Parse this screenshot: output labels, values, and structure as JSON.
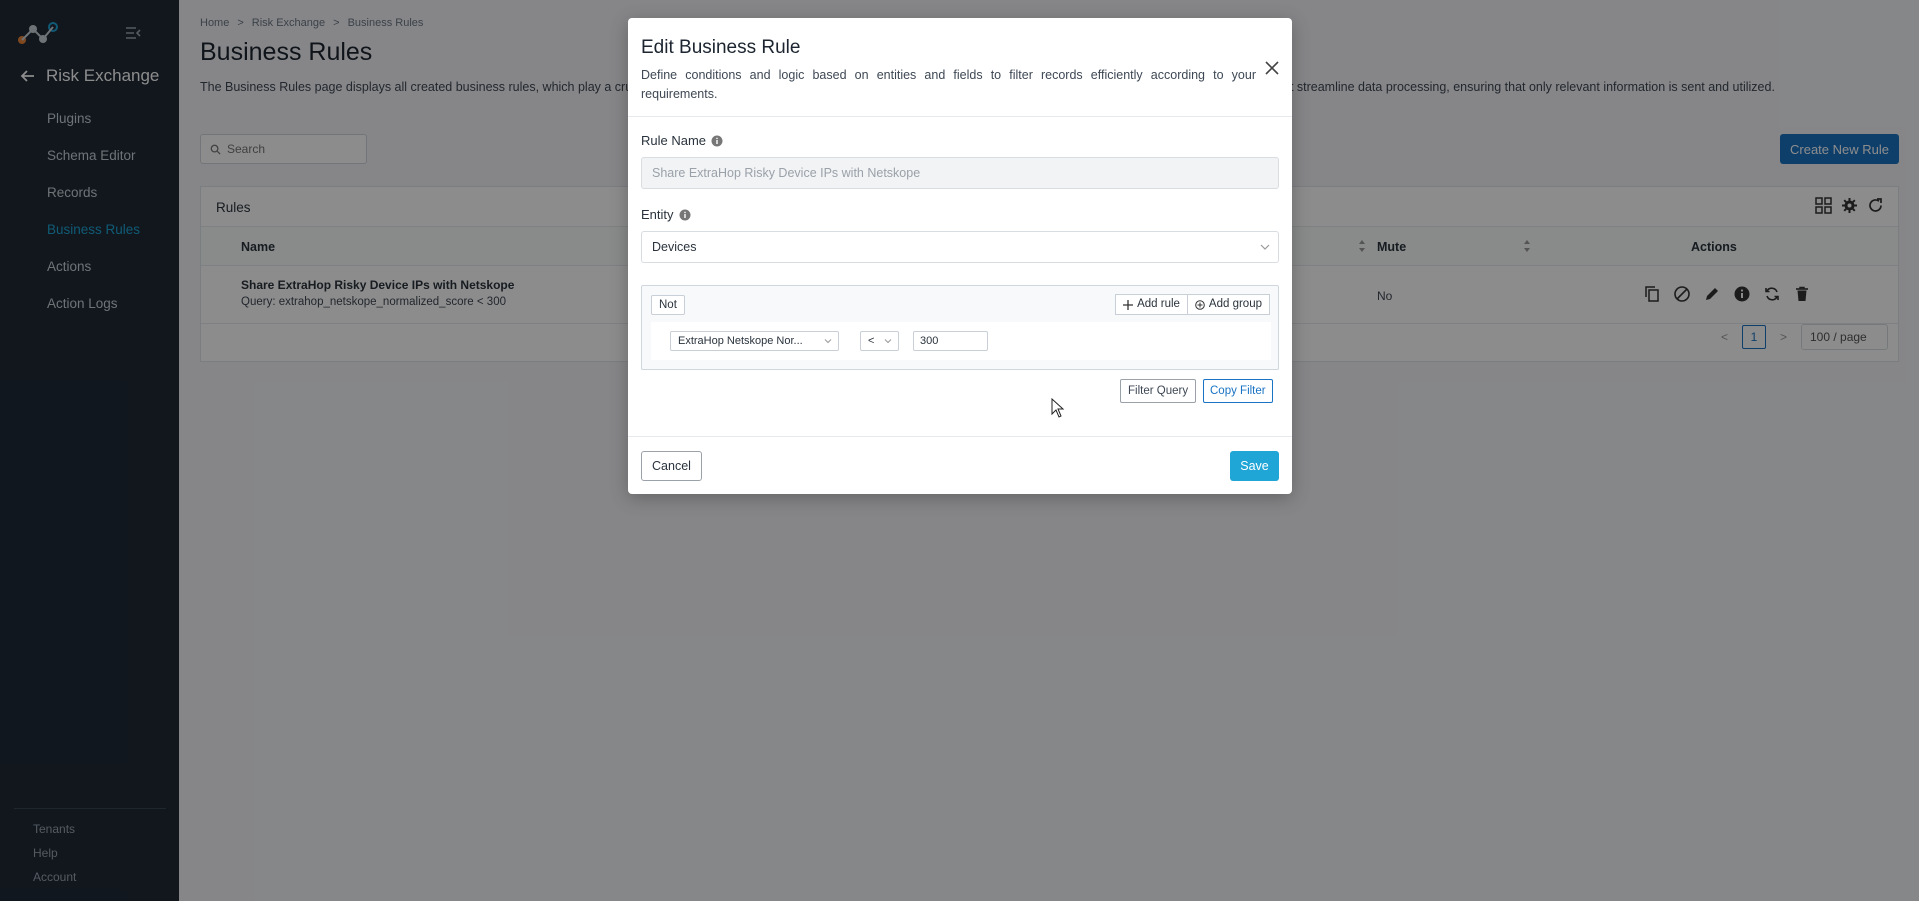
{
  "app": {
    "title": "Risk Exchange",
    "accent": "#1fa5d6",
    "primary": "#1a73c4"
  },
  "sidebar": {
    "items": [
      {
        "label": "Plugins"
      },
      {
        "label": "Schema Editor"
      },
      {
        "label": "Records"
      },
      {
        "label": "Business Rules"
      },
      {
        "label": "Actions"
      },
      {
        "label": "Action Logs"
      }
    ],
    "footer": [
      {
        "label": "Tenants"
      },
      {
        "label": "Help"
      },
      {
        "label": "Account"
      }
    ]
  },
  "breadcrumb": [
    "Home",
    ">",
    "Risk Exchange",
    ">",
    "Business Rules"
  ],
  "page": {
    "title": "Business Rules",
    "description": "The Business Rules page displays all created business rules, which play a cruci",
    "description_tail": "at streamline data processing, ensuring that only relevant information is sent and utilized.",
    "search_placeholder": "Search",
    "create_label": "Create New Rule"
  },
  "rules_table": {
    "title": "Rules",
    "columns": {
      "name": "Name",
      "mute": "Mute",
      "actions": "Actions"
    },
    "rows": [
      {
        "name": "Share ExtraHop Risky Device IPs with Netskope",
        "query": "Query: extrahop_netskope_normalized_score < 300",
        "mute": "No"
      }
    ],
    "pagination": {
      "prev": "<",
      "current": "1",
      "next": ">",
      "page_size": "100 / page"
    }
  },
  "modal": {
    "title": "Edit Business Rule",
    "description": "Define conditions and logic based on entities and fields to filter records efficiently according to your requirements.",
    "rule_name_label": "Rule Name",
    "rule_name_value": "Share ExtraHop Risky Device IPs with Netskope",
    "entity_label": "Entity",
    "entity_value": "Devices",
    "query_builder": {
      "not_label": "Not",
      "add_rule_label": "Add rule",
      "add_group_label": "Add group",
      "field_value": "ExtraHop Netskope Nor...",
      "operator_value": "<",
      "value": "300"
    },
    "filter_query_label": "Filter Query",
    "copy_filter_label": "Copy Filter",
    "cancel_label": "Cancel",
    "save_label": "Save"
  }
}
